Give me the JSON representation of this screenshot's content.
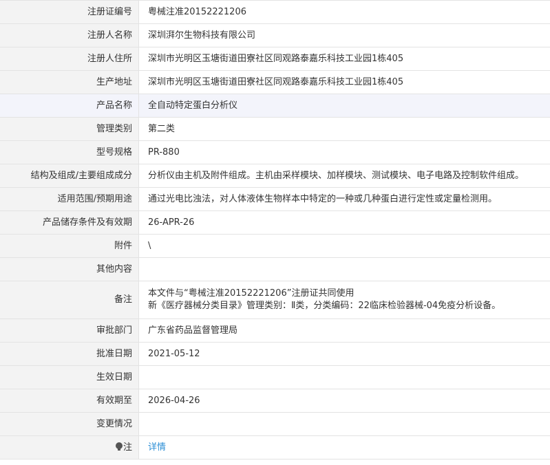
{
  "rows": [
    {
      "label": "注册证编号",
      "value": "粤械注准20152221206"
    },
    {
      "label": "注册人名称",
      "value": "深圳湃尔生物科技有限公司"
    },
    {
      "label": "注册人住所",
      "value": "深圳市光明区玉塘街道田寮社区同观路泰嘉乐科技工业园1栋405"
    },
    {
      "label": "生产地址",
      "value": "深圳市光明区玉塘街道田寮社区同观路泰嘉乐科技工业园1栋405"
    },
    {
      "label": "产品名称",
      "value": "全自动特定蛋白分析仪"
    },
    {
      "label": "管理类别",
      "value": "第二类"
    },
    {
      "label": "型号规格",
      "value": "PR-880"
    },
    {
      "label": "结构及组成/主要组成成分",
      "value": "分析仪由主机及附件组成。主机由采样模块、加样模块、测试模块、电子电路及控制软件组成。"
    },
    {
      "label": "适用范围/预期用途",
      "value": "通过光电比浊法，对人体液体生物样本中特定的一种或几种蛋白进行定性或定量检测用。"
    },
    {
      "label": "产品储存条件及有效期",
      "value": "26-APR-26"
    },
    {
      "label": "附件",
      "value": "\\"
    },
    {
      "label": "其他内容",
      "value": ""
    },
    {
      "label": "备注",
      "value_lines": [
        "本文件与“粤械注准20152221206”注册证共同使用",
        "新《医疗器械分类目录》管理类别：Ⅱ类，分类编码：22临床检验器械-04免疫分析设备。"
      ]
    },
    {
      "label": "审批部门",
      "value": "广东省药品监督管理局"
    },
    {
      "label": "批准日期",
      "value": "2021-05-12"
    },
    {
      "label": "生效日期",
      "value": ""
    },
    {
      "label": "有效期至",
      "value": "2026-04-26"
    },
    {
      "label": "变更情况",
      "value": ""
    },
    {
      "label": "注",
      "value": "详情",
      "icon": "lightbulb-icon"
    }
  ]
}
